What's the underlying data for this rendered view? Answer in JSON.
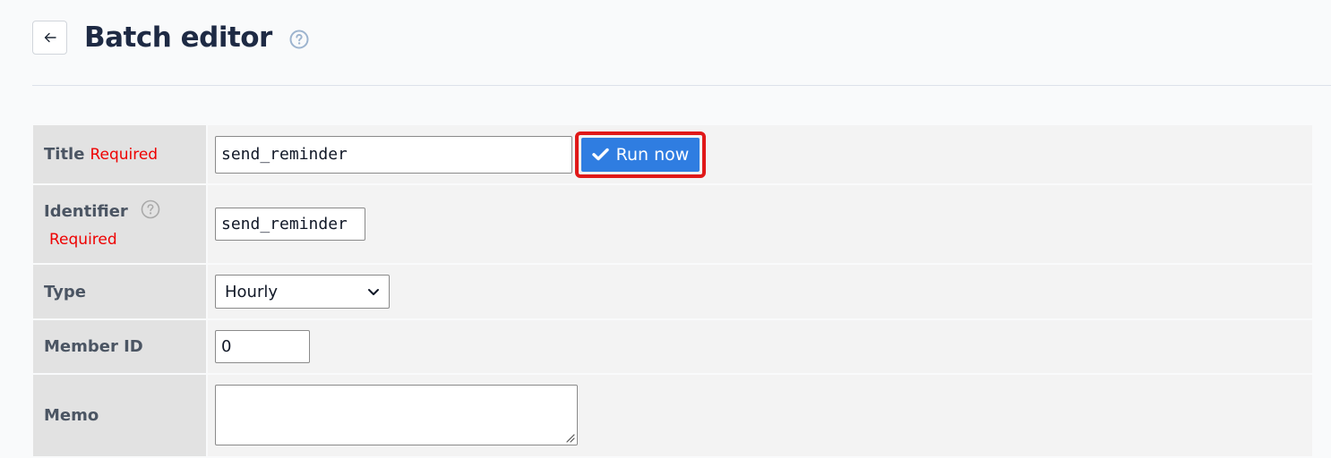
{
  "header": {
    "title": "Batch editor",
    "back_icon": "arrow-left-icon",
    "help_icon": "question-circle-icon"
  },
  "form": {
    "title": {
      "label": "Title",
      "required": "Required",
      "value": "send_reminder"
    },
    "run_button": {
      "label": "Run now",
      "icon": "checkmark-icon",
      "color": "#2f7de1",
      "highlight_color": "#e01919"
    },
    "identifier": {
      "label": "Identifier",
      "required": "Required",
      "value": "send_reminder",
      "help_icon": "question-circle-icon"
    },
    "type": {
      "label": "Type",
      "selected": "Hourly",
      "icon": "chevron-down-icon"
    },
    "member_id": {
      "label": "Member ID",
      "value": "0"
    },
    "memo": {
      "label": "Memo",
      "value": ""
    }
  },
  "colors": {
    "label_bg": "#e2e2e2",
    "value_bg": "#f3f3f3",
    "required": "#ee0000",
    "title_text": "#1e2a44"
  }
}
